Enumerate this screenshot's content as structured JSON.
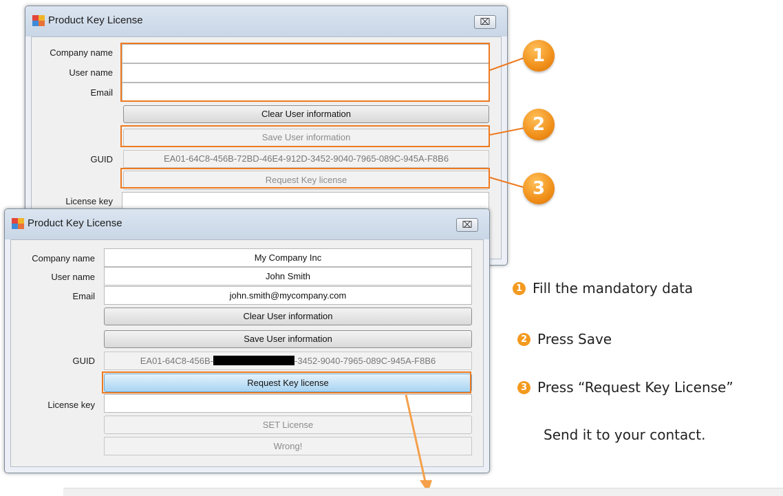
{
  "window_back": {
    "title": "Product Key License",
    "close": "⌧",
    "labels": {
      "company": "Company name",
      "user": "User name",
      "email": "Email",
      "guid": "GUID",
      "license": "License key"
    },
    "company_value": "",
    "user_value": "",
    "email_value": "",
    "clear_btn": "Clear User information",
    "save_btn": "Save User information",
    "guid_value": "EA01-64C8-456B-72BD-46E4-912D-3452-9040-7965-089C-945A-F8B6",
    "request_btn": "Request Key license"
  },
  "window_front": {
    "title": "Product Key License",
    "close": "⌧",
    "labels": {
      "company": "Company name",
      "user": "User name",
      "email": "Email",
      "guid": "GUID",
      "license": "License key"
    },
    "company_value": "My Company Inc",
    "user_value": "John Smith",
    "email_value": "john.smith@mycompany.com",
    "clear_btn": "Clear User information",
    "save_btn": "Save User information",
    "guid_prefix": "EA01-64C8-456B-",
    "guid_suffix": "-3452-9040-7965-089C-945A-F8B6",
    "request_btn": "Request Key license",
    "set_license_btn": "SET License",
    "status": "Wrong!"
  },
  "badges": [
    "1",
    "2",
    "3"
  ],
  "steps": {
    "s1_num": "1",
    "s1": "Fill the mandatory data",
    "s2_num": "2",
    "s2": "Press Save",
    "s3_num": "3",
    "s3": "Press “Request Key License”",
    "s4": "Send it to your contact."
  },
  "colors": {
    "accent": "#ee7a1f",
    "badge": "#f39a1f"
  }
}
